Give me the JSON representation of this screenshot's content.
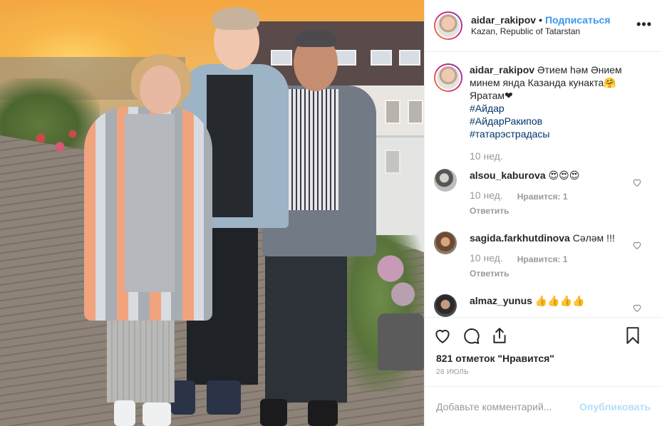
{
  "header": {
    "username": "aidar_rakipov",
    "separator": "•",
    "follow_label": "Подписаться",
    "location": "Kazan, Republic of Tatarstan",
    "more_label": "•••"
  },
  "caption": {
    "username": "aidar_rakipov",
    "text": "Әтием һәм Әнием минем янда Казанда кунакта🤗 Яратам❤",
    "hashtags": [
      "#Айдар",
      "#АйдарРакипов",
      "#татарэстрадасы"
    ],
    "time": "10 нед."
  },
  "comments": [
    {
      "username": "alsou_kaburova",
      "text": "😍😍😍",
      "time": "10 нед.",
      "likes": "Нравится: 1",
      "reply": "Ответить"
    },
    {
      "username": "sagida.farkhutdinova",
      "text": "Сәләм !!!",
      "time": "10 нед.",
      "likes": "Нравится: 1",
      "reply": "Ответить"
    },
    {
      "username": "almaz_yunus",
      "text": "👍👍👍👍",
      "time": "",
      "likes": "",
      "reply": ""
    }
  ],
  "likes_text": "821 отметок \"Нравится\"",
  "date": "28 ИЮЛЬ",
  "add_comment": {
    "placeholder": "Добавьте комментарий...",
    "publish_label": "Опубликовать"
  },
  "colors": {
    "link_blue": "#3897f0",
    "hashtag_blue": "#003569",
    "muted": "#999999",
    "publish_disabled": "#b2dffc"
  },
  "icons": [
    "heart-icon",
    "comment-icon",
    "share-icon",
    "bookmark-icon",
    "more-icon"
  ]
}
